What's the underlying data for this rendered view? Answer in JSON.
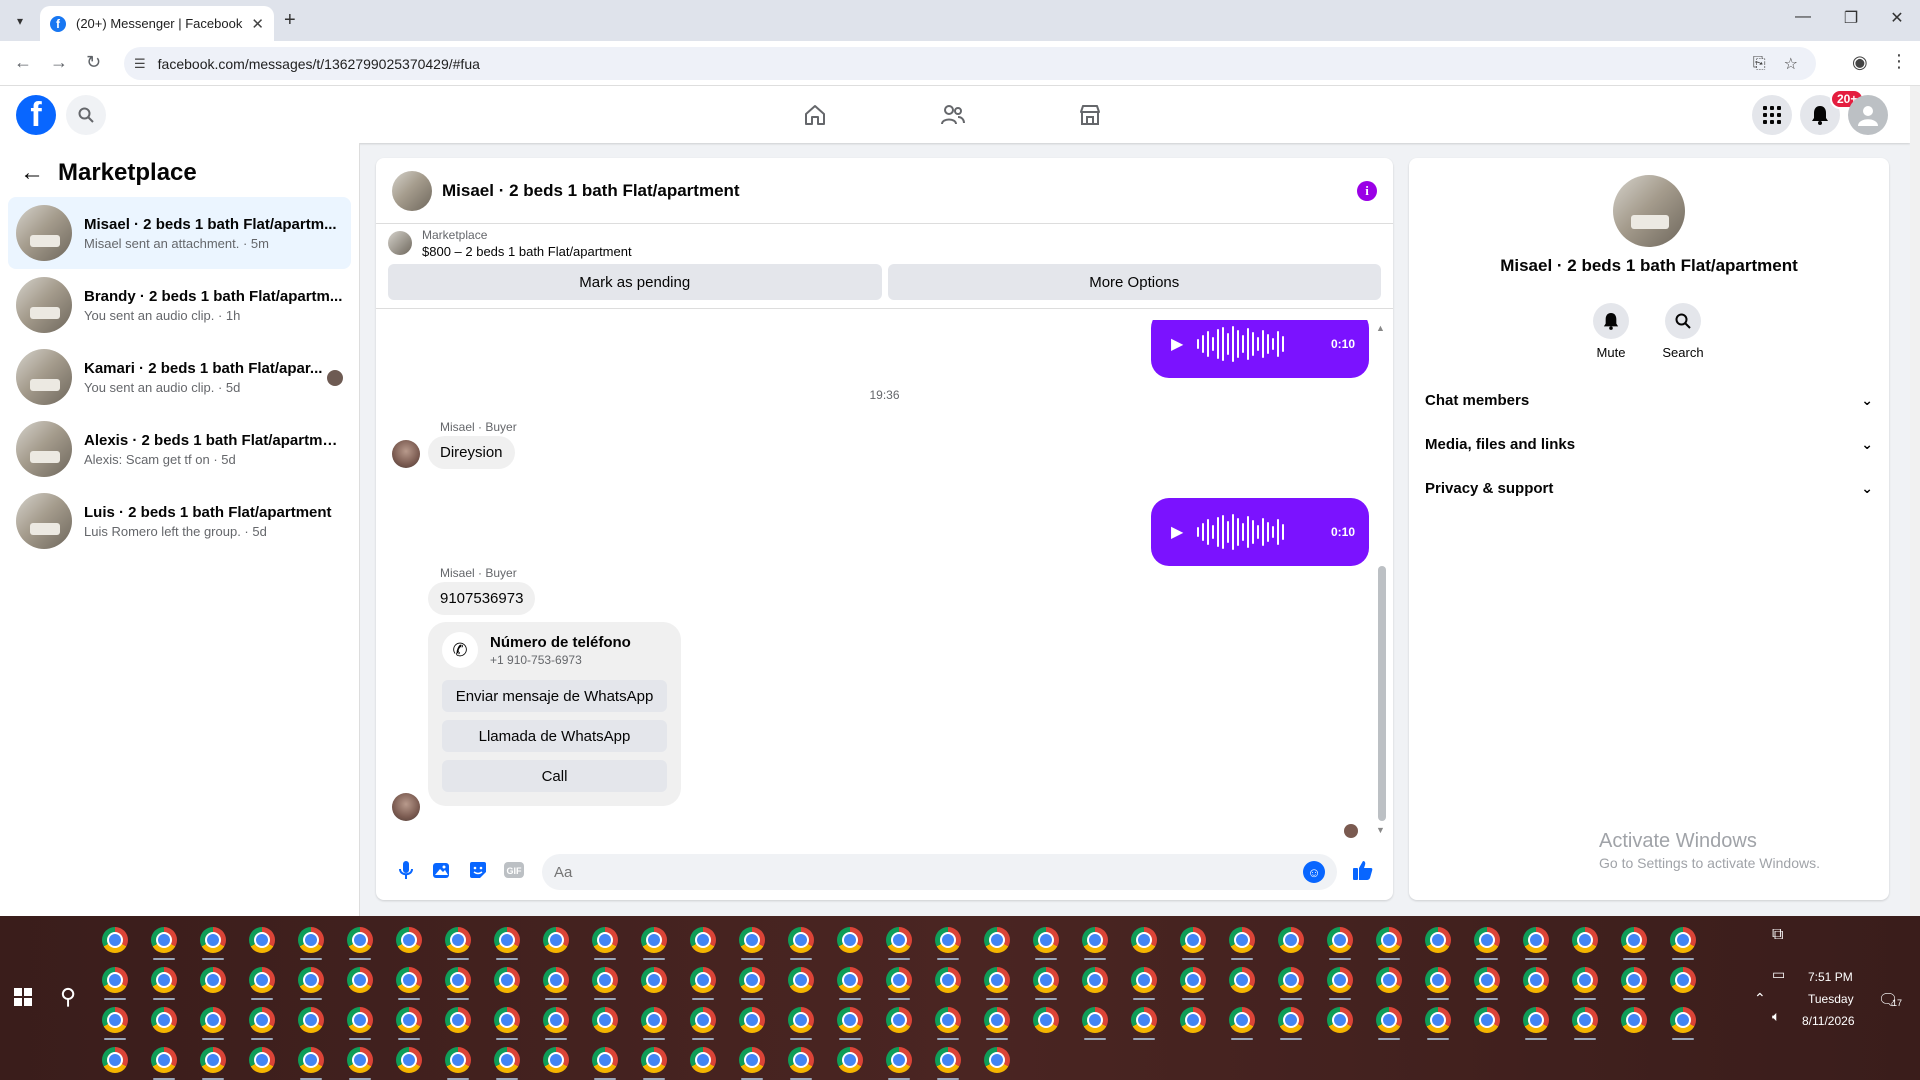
{
  "browser": {
    "tab_title": "(20+) Messenger | Facebook",
    "url": "facebook.com/messages/t/1362799025370429/#fua",
    "new_tab": "+",
    "close_tab": "✕"
  },
  "header": {
    "notification_badge": "20+"
  },
  "left_panel": {
    "title": "Marketplace",
    "conversations": [
      {
        "name": "Misael · 2 beds 1 bath Flat/apartm...",
        "preview": "Misael sent an attachment. · 5m"
      },
      {
        "name": "Brandy · 2 beds 1 bath Flat/apartm...",
        "preview": "You sent an audio clip. · 1h"
      },
      {
        "name": "Kamari · 2 beds 1 bath Flat/apar...",
        "preview": "You sent an audio clip. · 5d"
      },
      {
        "name": "Alexis · 2 beds 1 bath Flat/apartme...",
        "preview": "Alexis: Scam get tf on · 5d"
      },
      {
        "name": "Luis · 2 beds 1 bath Flat/apartment",
        "preview": "Luis Romero left the group. · 5d"
      }
    ]
  },
  "chat": {
    "title": "Misael · 2 beds 1 bath Flat/apartment",
    "listing_label": "Marketplace",
    "listing_price": "$800 – 2 beds 1 bath Flat/apartment",
    "mark_pending": "Mark as pending",
    "more_options": "More Options",
    "timestamp": "19:36",
    "sender_label": "Misael · Buyer",
    "audio_duration": "0:10",
    "message_1": "Direysion",
    "message_2": "9107536973",
    "card": {
      "title": "Número de teléfono",
      "number": "+1 910-753-6973",
      "btn_whatsapp_msg": "Enviar mensaje de WhatsApp",
      "btn_whatsapp_call": "Llamada de WhatsApp",
      "btn_call": "Call"
    },
    "composer_placeholder": "Aa"
  },
  "right_panel": {
    "name": "Misael · 2 beds 1 bath Flat/apartment",
    "mute": "Mute",
    "search": "Search",
    "sections": [
      "Chat members",
      "Media, files and links",
      "Privacy & support"
    ],
    "activate_title": "Activate Windows",
    "activate_sub": "Go to Settings to activate Windows."
  },
  "taskbar": {
    "time": "7:51 PM",
    "day": "Tuesday",
    "date": "8/11/2026",
    "notif_count": "17"
  },
  "colors": {
    "accent": "#0866ff",
    "audio_bubble": "#7b12ff",
    "badge": "#e41e3f"
  }
}
